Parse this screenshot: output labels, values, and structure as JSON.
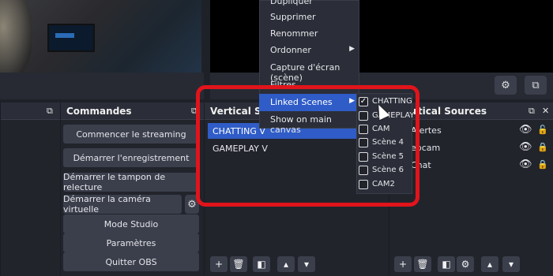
{
  "colors": {
    "accent": "#2f5cc7",
    "highlight_frame": "#e1141b"
  },
  "commands": {
    "title": "Commandes",
    "buttons": [
      "Commencer le streaming",
      "Démarrer l'enregistrement",
      "Démarrer le tampon de relecture",
      "Démarrer la caméra virtuelle",
      "Mode Studio",
      "Paramètres",
      "Quitter OBS"
    ]
  },
  "scenes": {
    "title": "Vertical Scè",
    "items": [
      "CHATTING V",
      "GAMEPLAY V"
    ]
  },
  "sources": {
    "title": "rtical Sources",
    "items": [
      "Alertes",
      "ebcam",
      "Chat"
    ]
  },
  "context_menu": {
    "items": [
      "Dupliquer",
      "Supprimer",
      "Renommer",
      "Ordonner",
      "Capture d'écran (scène)",
      "Filtres",
      "Linked Scenes",
      "Show on main canvas"
    ]
  },
  "linked_scenes": {
    "items": [
      {
        "label": "CHATTING",
        "checked": true
      },
      {
        "label": "GAMEPLAY",
        "checked": false
      },
      {
        "label": "CAM",
        "checked": false
      },
      {
        "label": "Scène 4",
        "checked": false
      },
      {
        "label": "Scène 5",
        "checked": false
      },
      {
        "label": "Scène 6",
        "checked": false
      },
      {
        "label": "CAM2",
        "checked": false
      }
    ]
  }
}
